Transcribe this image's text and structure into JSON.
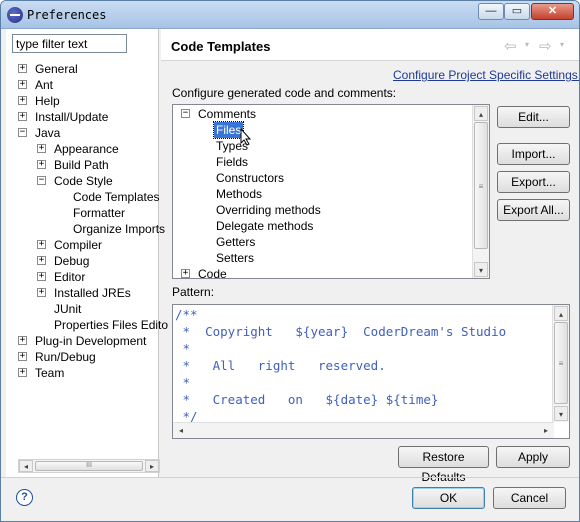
{
  "window": {
    "title": "Preferences"
  },
  "titlebar": {
    "minimize": "—",
    "maximize": "▭",
    "close": "✕"
  },
  "filter": {
    "placeholder": "type filter text",
    "value": "type filter text"
  },
  "tree": [
    {
      "label": "General",
      "exp": "+"
    },
    {
      "label": "Ant",
      "exp": "+"
    },
    {
      "label": "Help",
      "exp": "+"
    },
    {
      "label": "Install/Update",
      "exp": "+"
    },
    {
      "label": "Java",
      "exp": "−"
    },
    {
      "label": "Appearance",
      "exp": "+"
    },
    {
      "label": "Build Path",
      "exp": "+"
    },
    {
      "label": "Code Style",
      "exp": "−"
    },
    {
      "label": "Code Templates"
    },
    {
      "label": "Formatter"
    },
    {
      "label": "Organize Imports"
    },
    {
      "label": "Compiler",
      "exp": "+"
    },
    {
      "label": "Debug",
      "exp": "+"
    },
    {
      "label": "Editor",
      "exp": "+"
    },
    {
      "label": "Installed JREs",
      "exp": "+"
    },
    {
      "label": "JUnit"
    },
    {
      "label": "Properties Files Edito"
    },
    {
      "label": "Plug-in Development",
      "exp": "+"
    },
    {
      "label": "Run/Debug",
      "exp": "+"
    },
    {
      "label": "Team",
      "exp": "+"
    }
  ],
  "left_scroll": {
    "left": "◂",
    "thumb": "III",
    "right": "▸"
  },
  "header": {
    "title": "Code Templates",
    "back": "⇦",
    "forward": "⇨",
    "dropdown": "▾"
  },
  "main": {
    "link": "Configure Project Specific Settings...",
    "configure_label": "Configure generated code and comments:",
    "templates": [
      {
        "label": "Comments",
        "exp": "−"
      },
      {
        "label": "Files"
      },
      {
        "label": "Types"
      },
      {
        "label": "Fields"
      },
      {
        "label": "Constructors"
      },
      {
        "label": "Methods"
      },
      {
        "label": "Overriding methods"
      },
      {
        "label": "Delegate methods"
      },
      {
        "label": "Getters"
      },
      {
        "label": "Setters"
      },
      {
        "label": "Code",
        "exp": "+"
      }
    ],
    "scroll": {
      "up": "▴",
      "thumb": "≡",
      "down": "▾"
    },
    "buttons": {
      "edit": "Edit...",
      "import": "Import...",
      "export": "Export...",
      "export_all": "Export All..."
    },
    "pattern_label": "Pattern:",
    "pattern_lines": [
      "/**",
      " *  Copyright   ${year}  CoderDream's Studio",
      " *",
      " *   All   right   reserved.",
      " *",
      " *   Created   on   ${date} ${time}",
      " */"
    ],
    "pattern_scroll": {
      "left": "◂",
      "right": "▸"
    },
    "restore_defaults": "Restore Defaults",
    "apply": "Apply"
  },
  "footer": {
    "help": "?",
    "ok": "OK",
    "cancel": "Cancel"
  }
}
